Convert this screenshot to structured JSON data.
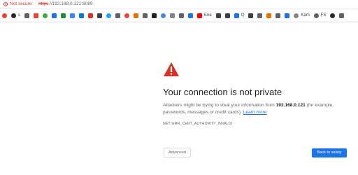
{
  "address_bar": {
    "security_label": "Not secure",
    "url_scheme": "https",
    "url_rest": "://192.168.0.121:8089"
  },
  "bookmarks": [
    {
      "icon": "chrome-icon",
      "label": "",
      "color": "#ea4335",
      "round": true
    },
    {
      "icon": "github-icon",
      "label": "s",
      "color": "#24292e",
      "round": true
    },
    {
      "icon": "bookmark-icon",
      "label": "",
      "color": "#5f6368",
      "round": false
    },
    {
      "icon": "bookmark-icon",
      "label": "",
      "color": "#ea4335",
      "round": false
    },
    {
      "icon": "bookmark-icon",
      "label": "",
      "color": "#34a853",
      "round": true
    },
    {
      "icon": "bookmark-icon",
      "label": "",
      "color": "#1a73e8",
      "round": false
    },
    {
      "icon": "bookmark-icon",
      "label": "",
      "color": "#1e8e3e",
      "round": false
    },
    {
      "icon": "bookmark-icon",
      "label": "",
      "color": "#4285f4",
      "round": false
    },
    {
      "icon": "bookmark-icon",
      "label": "",
      "color": "#0078d4",
      "round": false
    },
    {
      "icon": "bookmark-icon",
      "label": "",
      "color": "#d93025",
      "round": false
    },
    {
      "icon": "bookmark-icon",
      "label": "",
      "color": "#3c4043",
      "round": false
    },
    {
      "icon": "twitter-icon",
      "label": "",
      "color": "#1da1f2",
      "round": true
    },
    {
      "icon": "bookmark-icon",
      "label": "",
      "color": "#5f6368",
      "round": false
    },
    {
      "icon": "bookmark-icon",
      "label": "",
      "color": "#ea4335",
      "round": true
    },
    {
      "icon": "bookmark-icon",
      "label": "",
      "color": "#e37400",
      "round": false
    },
    {
      "icon": "bookmark-icon",
      "label": "",
      "color": "#5f6368",
      "round": false
    },
    {
      "icon": "bookmark-icon",
      "label": "",
      "color": "#202124",
      "round": false
    },
    {
      "icon": "bookmark-icon",
      "label": "",
      "color": "#4285f4",
      "round": true
    },
    {
      "icon": "bookmark-icon",
      "label": "",
      "color": "#80868b",
      "round": false
    },
    {
      "icon": "bookmark-icon",
      "label": "",
      "color": "#5f6368",
      "round": false
    },
    {
      "icon": "bookmark-icon",
      "label": "",
      "color": "#1a73e8",
      "round": false
    },
    {
      "icon": "youtube-icon",
      "label": "Ene",
      "color": "#ff0000",
      "round": false
    },
    {
      "icon": "bookmark-icon",
      "label": "",
      "color": "#3c4043",
      "round": false
    },
    {
      "icon": "bookmark-icon",
      "label": "",
      "color": "#3c4043",
      "round": false
    },
    {
      "icon": "bookmark-icon",
      "label": "Q",
      "color": "#1a73e8",
      "round": false
    },
    {
      "icon": "bookmark-icon",
      "label": "",
      "color": "#3c4043",
      "round": false
    },
    {
      "icon": "bookmark-icon",
      "label": "",
      "color": "#5f6368",
      "round": false
    },
    {
      "icon": "bookmark-icon",
      "label": "",
      "color": "#e37400",
      "round": false
    },
    {
      "icon": "bookmark-icon",
      "label": "",
      "color": "#5f6368",
      "round": false
    },
    {
      "icon": "bookmark-icon",
      "label": "",
      "color": "#1a73e8",
      "round": false
    },
    {
      "icon": "bookmark-icon",
      "label": "Kam",
      "color": "#80868b",
      "round": true
    },
    {
      "icon": "chat-icon",
      "label": "FS",
      "color": "#5f6368",
      "round": true
    },
    {
      "icon": "github-icon",
      "label": "",
      "color": "#24292e",
      "round": true
    },
    {
      "icon": "bookmark-icon",
      "label": "",
      "color": "#5f6368",
      "round": false
    }
  ],
  "interstitial": {
    "icon": "warning-icon",
    "accent_color": "#d93025",
    "heading": "Your connection is not private",
    "message_prefix": "Attackers might be trying to steal your information from ",
    "message_host": "192.168.0.121",
    "message_suffix": " (for example, passwords, messages or credit cards). ",
    "learn_more": "Learn more",
    "error_code": "NET::ERR_CERT_AUTHORITY_INVALID",
    "advanced_label": "Advanced",
    "back_label": "Back to safety",
    "primary_color": "#1a73e8"
  }
}
